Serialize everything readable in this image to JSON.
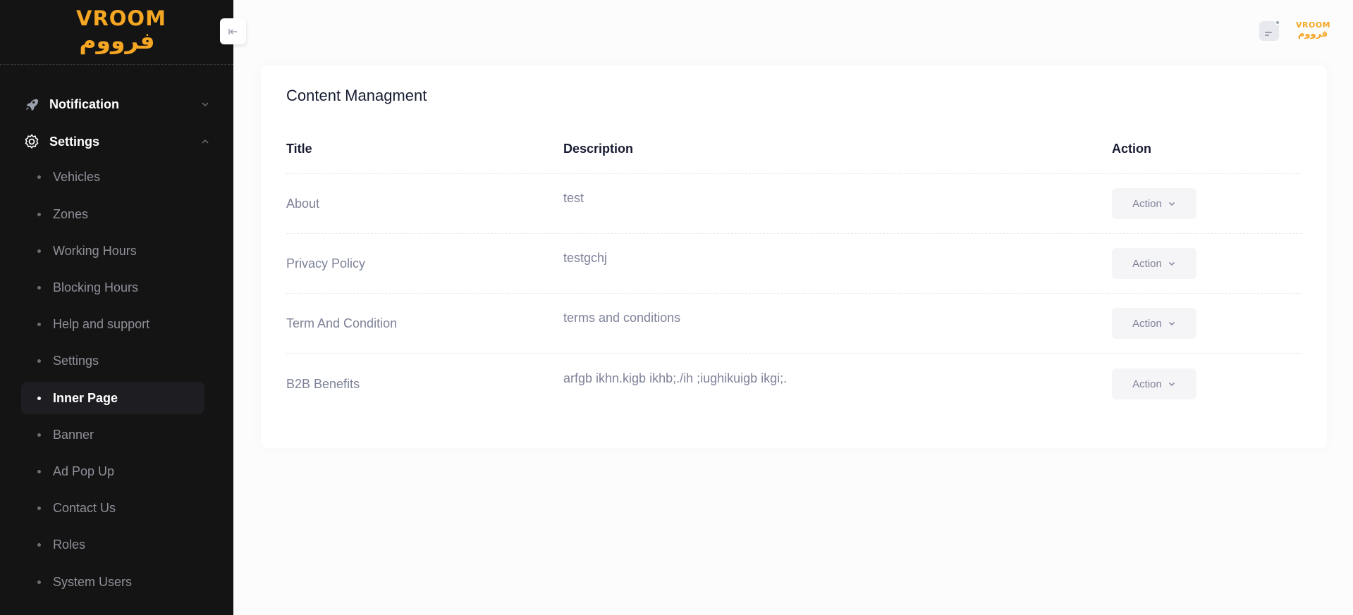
{
  "brand": {
    "name_en": "VROOM",
    "name_ar": "فرووم",
    "color": "#f5a623"
  },
  "sidebar": {
    "groups": [
      {
        "label": "Notification",
        "icon": "rocket-icon",
        "expanded": false
      },
      {
        "label": "Settings",
        "icon": "gear-icon",
        "expanded": true
      }
    ],
    "items": [
      {
        "label": "Vehicles"
      },
      {
        "label": "Zones"
      },
      {
        "label": "Working Hours"
      },
      {
        "label": "Blocking Hours"
      },
      {
        "label": "Help and support"
      },
      {
        "label": "Settings"
      },
      {
        "label": "Inner Page",
        "active": true
      },
      {
        "label": "Banner"
      },
      {
        "label": "Ad Pop Up"
      },
      {
        "label": "Contact Us"
      },
      {
        "label": "Roles"
      },
      {
        "label": "System Users"
      }
    ]
  },
  "content": {
    "title": "Content Managment",
    "columns": {
      "title": "Title",
      "description": "Description",
      "action": "Action"
    },
    "rows": [
      {
        "title": "About",
        "description": "test",
        "action": "Action"
      },
      {
        "title": "Privacy Policy",
        "description": "testgchj",
        "action": "Action"
      },
      {
        "title": "Term And Condition",
        "description": "terms and conditions",
        "action": "Action"
      },
      {
        "title": "B2B Benefits",
        "description": "arfgb ikhn.kigb ikhb;./ih ;iughikuigb ikgi;.",
        "action": "Action"
      }
    ]
  }
}
